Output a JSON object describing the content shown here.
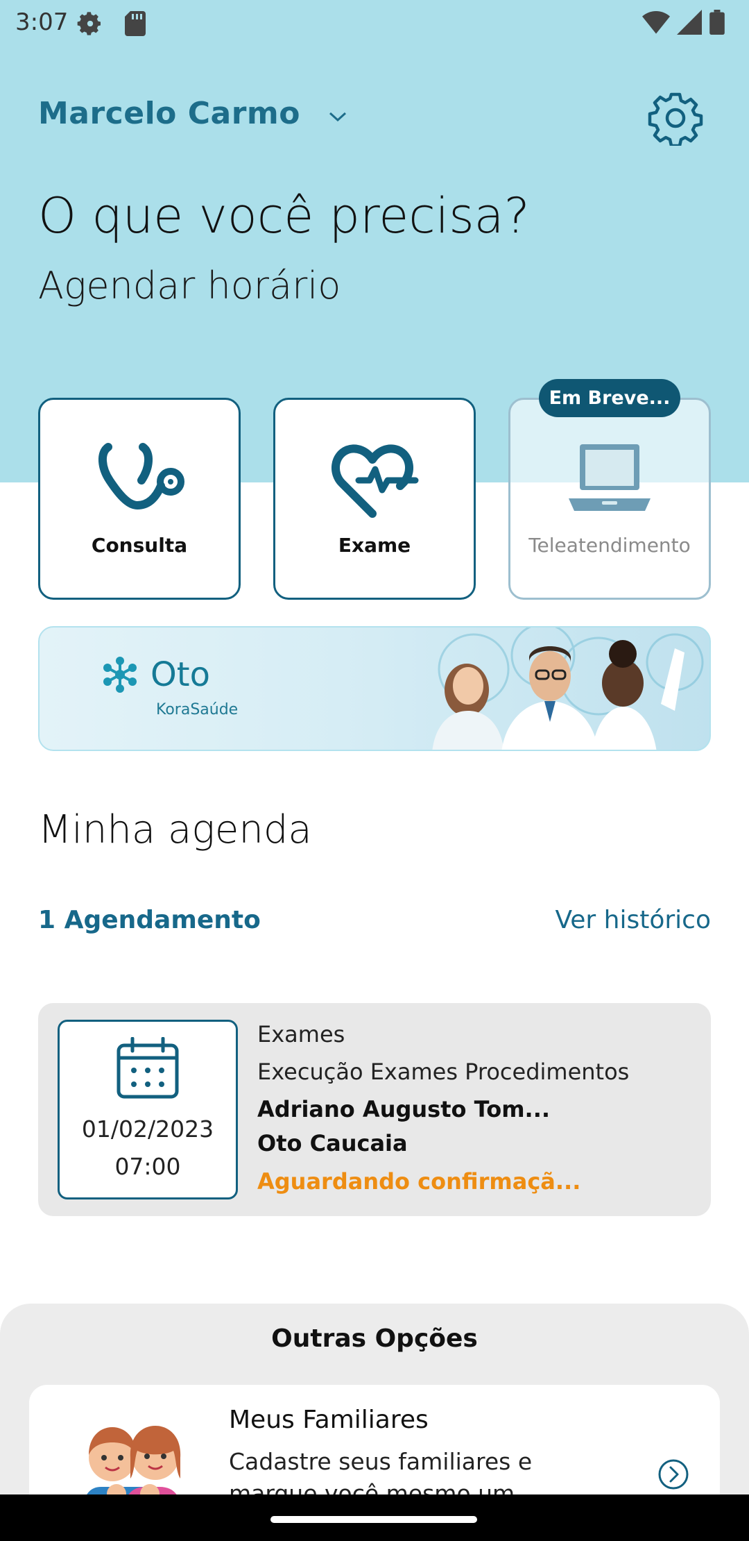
{
  "status_bar": {
    "time": "3:07",
    "icons": [
      "settings-gear-icon",
      "sd-card-icon",
      "wifi-icon",
      "signal-icon",
      "battery-icon"
    ]
  },
  "header": {
    "user_name": "Marcelo Carmo",
    "headline": "O que você precisa?",
    "subheadline": "Agendar horário"
  },
  "services": [
    {
      "label": "Consulta",
      "icon": "stethoscope-icon",
      "enabled": true
    },
    {
      "label": "Exame",
      "icon": "heartbeat-icon",
      "enabled": true
    },
    {
      "label": "Teleatendimento",
      "icon": "laptop-icon",
      "enabled": false,
      "badge": "Em Breve..."
    }
  ],
  "banner": {
    "brand": "Oto",
    "sub_brand": "KoraSaúde"
  },
  "agenda": {
    "title": "Minha agenda",
    "count_label": "1 Agendamento",
    "history_link": "Ver histórico",
    "appointments": [
      {
        "date": "01/02/2023",
        "time": "07:00",
        "category": "Exames",
        "procedure": "Execução Exames Procedimentos",
        "professional": "Adriano Augusto Tom...",
        "location": "Oto Caucaia",
        "status": "Aguardando confirmaçã..."
      }
    ]
  },
  "other_options": {
    "title": "Outras Opções",
    "items": [
      {
        "title": "Meus Familiares",
        "description": "Cadastre seus familiares e marque você mesmo um"
      }
    ]
  },
  "colors": {
    "header_bg": "#abdfea",
    "primary": "#12607f",
    "accent_text": "#17688a",
    "status_pending": "#ee8d12",
    "card_bg": "#e8e8e8"
  }
}
